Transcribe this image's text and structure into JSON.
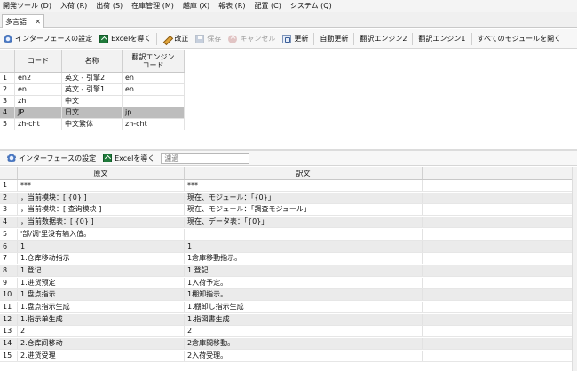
{
  "menubar": {
    "items": [
      "開発ツール (D)",
      "入荷 (R)",
      "出荷 (S)",
      "在庫管理 (M)",
      "越庫 (X)",
      "報表 (R)",
      "配置 (C)",
      "システム (Q)"
    ]
  },
  "tab": {
    "label": "多言語",
    "close": "✕"
  },
  "toolbar_top": {
    "interface_settings": "インターフェースの設定",
    "export_excel": "Excelを導く",
    "edit": "改正",
    "save": "保存",
    "cancel": "キャンセル",
    "refresh": "更新",
    "auto_update": "自動更新",
    "engine2": "翻訳エンジン2",
    "engine1": "翻訳エンジン1",
    "open_all": "すべてのモジュールを開く"
  },
  "grid1": {
    "headers": {
      "code": "コード",
      "name": "名称",
      "engine_code": "翻訳エンジン\nコード"
    },
    "rows": [
      {
        "num": "1",
        "code": "en2",
        "name": "英文 - 引擎2",
        "engine": "en"
      },
      {
        "num": "2",
        "code": "en",
        "name": "英文 - 引擎1",
        "engine": "en"
      },
      {
        "num": "3",
        "code": "zh",
        "name": "中文",
        "engine": ""
      },
      {
        "num": "4",
        "code": "JP",
        "name": "日文",
        "engine": "jp"
      },
      {
        "num": "5",
        "code": "zh-cht",
        "name": "中文繁体",
        "engine": "zh-cht"
      }
    ],
    "selected_index": 3
  },
  "toolbar_bottom": {
    "interface_settings": "インターフェースの設定",
    "export_excel": "Excelを導く",
    "filter_placeholder": "濾過"
  },
  "grid2": {
    "headers": {
      "source": "原文",
      "translation": "訳文"
    },
    "rows": [
      {
        "num": "1",
        "source": "***",
        "translation": "***"
      },
      {
        "num": "2",
        "source": "，当前模块：[ {0} ]",
        "translation": "現在、モジュール：「{0}」"
      },
      {
        "num": "3",
        "source": "，当前模块：[ 查询模块 ]",
        "translation": "現在、モジュール：「調査モジュール」"
      },
      {
        "num": "4",
        "source": "，当前数据表：[ {0} ]",
        "translation": "現在、データ表：「{0}」"
      },
      {
        "num": "5",
        "source": "'部/调'里没有输入值。",
        "translation": ""
      },
      {
        "num": "6",
        "source": "1",
        "translation": "1"
      },
      {
        "num": "7",
        "source": "1.仓库移动指示",
        "translation": "1倉庫移動指示。"
      },
      {
        "num": "8",
        "source": "1.登记",
        "translation": "1.登記"
      },
      {
        "num": "9",
        "source": "1.进货预定",
        "translation": "1入荷予定。"
      },
      {
        "num": "10",
        "source": "1.盘点指示",
        "translation": "1棚卸指示。"
      },
      {
        "num": "11",
        "source": "1.盘点指示生成",
        "translation": "1.棚卸し指示生成"
      },
      {
        "num": "12",
        "source": "1.指示单生成",
        "translation": "1.指図書生成"
      },
      {
        "num": "13",
        "source": "2",
        "translation": "2"
      },
      {
        "num": "14",
        "source": "2.仓库间移动",
        "translation": "2倉庫間移動。"
      },
      {
        "num": "15",
        "source": "2.进货受理",
        "translation": "2入荷受理。"
      }
    ]
  }
}
